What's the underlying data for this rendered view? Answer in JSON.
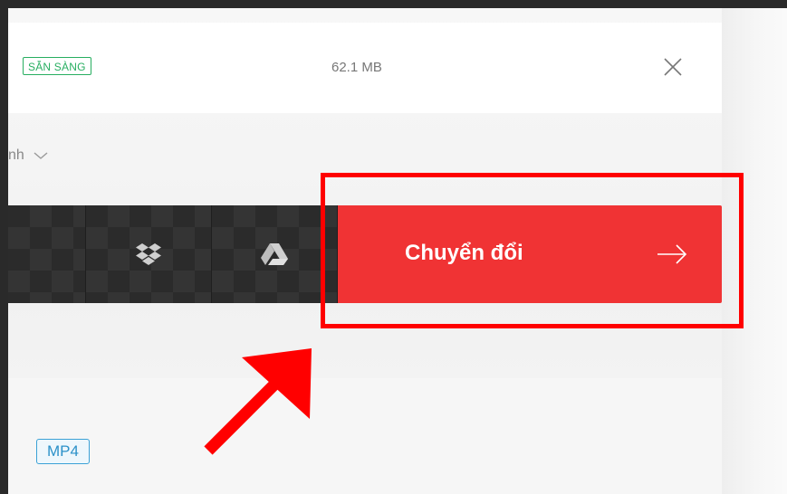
{
  "file": {
    "status": "SẴN SÀNG",
    "size": "62.1 MB",
    "close_icon": "close-icon"
  },
  "options": {
    "partial_label": "nh",
    "chevron_icon": "chevron-down-icon"
  },
  "actions": {
    "dropbox_icon": "dropbox-icon",
    "drive_icon": "google-drive-icon",
    "convert_label": "Chuyển đổi",
    "convert_arrow_icon": "arrow-right-icon"
  },
  "output": {
    "format": "MP4"
  },
  "annotations": {
    "highlight_color": "#ff0000",
    "arrow_color": "#ff0000"
  },
  "colors": {
    "accent_red": "#f03334",
    "status_green": "#27ae60",
    "format_blue": "#3ba1d6"
  }
}
